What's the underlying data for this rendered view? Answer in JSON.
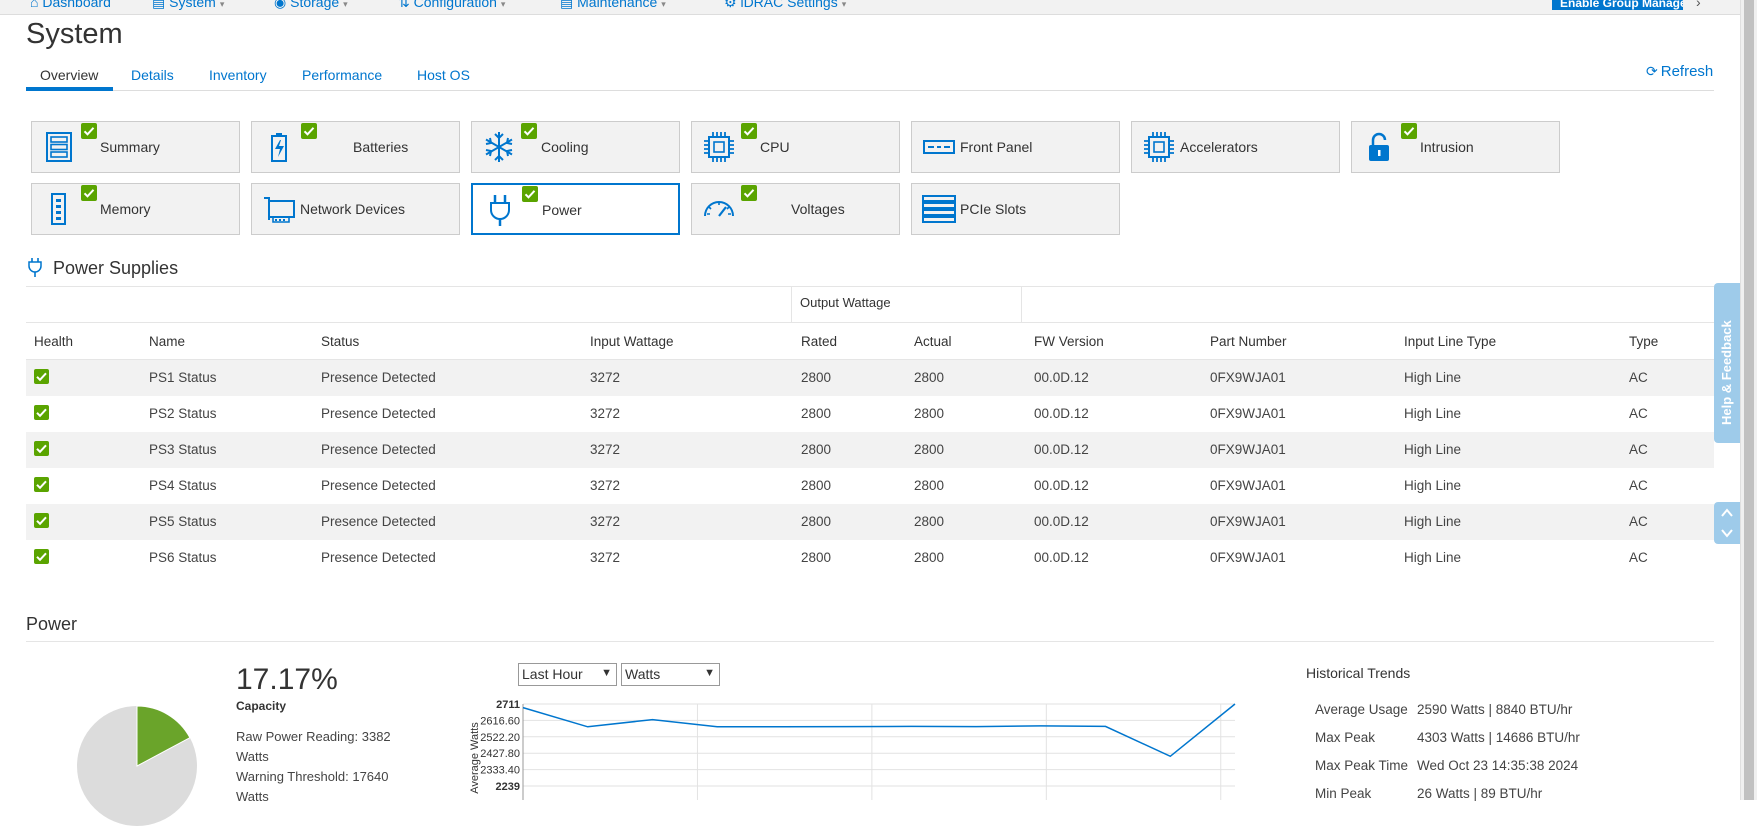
{
  "nav": {
    "items": [
      {
        "label": "Dashboard"
      },
      {
        "label": "System"
      },
      {
        "label": "Storage"
      },
      {
        "label": "Configuration"
      },
      {
        "label": "Maintenance"
      },
      {
        "label": "iDRAC Settings"
      }
    ],
    "launch_button": "Enable Group Manager"
  },
  "page": {
    "title": "System"
  },
  "tabs": [
    {
      "label": "Overview",
      "active": true
    },
    {
      "label": "Details"
    },
    {
      "label": "Inventory"
    },
    {
      "label": "Performance"
    },
    {
      "label": "Host OS"
    }
  ],
  "refresh_label": "Refresh",
  "tiles": [
    {
      "label": "Summary",
      "icon": "summary-icon",
      "check": true
    },
    {
      "label": "Batteries",
      "icon": "battery-icon",
      "check": true
    },
    {
      "label": "Cooling",
      "icon": "snowflake-icon",
      "check": true
    },
    {
      "label": "CPU",
      "icon": "cpu-icon",
      "check": true
    },
    {
      "label": "Front Panel",
      "icon": "front-panel-icon",
      "check": false
    },
    {
      "label": "Accelerators",
      "icon": "accelerator-icon",
      "check": false
    },
    {
      "label": "Intrusion",
      "icon": "lock-icon",
      "check": true
    },
    {
      "label": "Memory",
      "icon": "memory-icon",
      "check": true
    },
    {
      "label": "Network Devices",
      "icon": "network-card-icon",
      "check": false
    },
    {
      "label": "Power",
      "icon": "plug-icon",
      "check": true,
      "active": true
    },
    {
      "label": "Voltages",
      "icon": "gauge-icon",
      "check": true
    },
    {
      "label": "PCIe Slots",
      "icon": "pcie-icon",
      "check": false
    }
  ],
  "power_supplies": {
    "title": "Power Supplies",
    "group_header": "Output Wattage",
    "columns": [
      "Health",
      "Name",
      "Status",
      "Input Wattage",
      "Rated",
      "Actual",
      "FW Version",
      "Part Number",
      "Input Line Type",
      "Type"
    ],
    "rows": [
      {
        "name": "PS1 Status",
        "status": "Presence Detected",
        "input": "3272",
        "rated": "2800",
        "actual": "2800",
        "fw": "00.0D.12",
        "part": "0FX9WJA01",
        "line": "High Line",
        "type": "AC"
      },
      {
        "name": "PS2 Status",
        "status": "Presence Detected",
        "input": "3272",
        "rated": "2800",
        "actual": "2800",
        "fw": "00.0D.12",
        "part": "0FX9WJA01",
        "line": "High Line",
        "type": "AC"
      },
      {
        "name": "PS3 Status",
        "status": "Presence Detected",
        "input": "3272",
        "rated": "2800",
        "actual": "2800",
        "fw": "00.0D.12",
        "part": "0FX9WJA01",
        "line": "High Line",
        "type": "AC"
      },
      {
        "name": "PS4 Status",
        "status": "Presence Detected",
        "input": "3272",
        "rated": "2800",
        "actual": "2800",
        "fw": "00.0D.12",
        "part": "0FX9WJA01",
        "line": "High Line",
        "type": "AC"
      },
      {
        "name": "PS5 Status",
        "status": "Presence Detected",
        "input": "3272",
        "rated": "2800",
        "actual": "2800",
        "fw": "00.0D.12",
        "part": "0FX9WJA01",
        "line": "High Line",
        "type": "AC"
      },
      {
        "name": "PS6 Status",
        "status": "Presence Detected",
        "input": "3272",
        "rated": "2800",
        "actual": "2800",
        "fw": "00.0D.12",
        "part": "0FX9WJA01",
        "line": "High Line",
        "type": "AC"
      }
    ]
  },
  "help_label": "Help & Feedback",
  "power": {
    "title": "Power",
    "capacity_pct": "17.17%",
    "capacity_fraction": 0.1717,
    "capacity_label": "Capacity",
    "raw_reading": "Raw Power Reading: 3382 Watts",
    "warning_threshold": "Warning Threshold: 17640 Watts",
    "range_select": "Last Hour",
    "unit_select": "Watts",
    "colors": {
      "used": "#6aa42a",
      "free": "#dcdcdc",
      "line": "#0076ce"
    }
  },
  "chart_data": {
    "type": "line",
    "ylabel": "Average Watts",
    "ylim": [
      2239,
      2711
    ],
    "yticks": [
      "2711",
      "2616.60",
      "2522.20",
      "2427.80",
      "2333.40",
      "2239"
    ],
    "x": [
      0,
      1,
      2,
      3,
      4,
      5,
      6,
      7,
      8,
      9,
      10,
      11
    ],
    "series": [
      {
        "values": [
          2690,
          2580,
          2621,
          2580,
          2580,
          2581,
          2582,
          2581,
          2585,
          2582,
          2410,
          2711
        ]
      }
    ],
    "grid": true
  },
  "historical": {
    "title": "Historical Trends",
    "rows": [
      {
        "label": "Average Usage",
        "value": "2590 Watts | 8840 BTU/hr"
      },
      {
        "label": "Max Peak",
        "value": "4303 Watts | 14686 BTU/hr"
      },
      {
        "label": "Max Peak Time",
        "value": "Wed Oct 23 14:35:38 2024"
      },
      {
        "label": "Min Peak",
        "value": "26 Watts | 89 BTU/hr"
      }
    ]
  }
}
